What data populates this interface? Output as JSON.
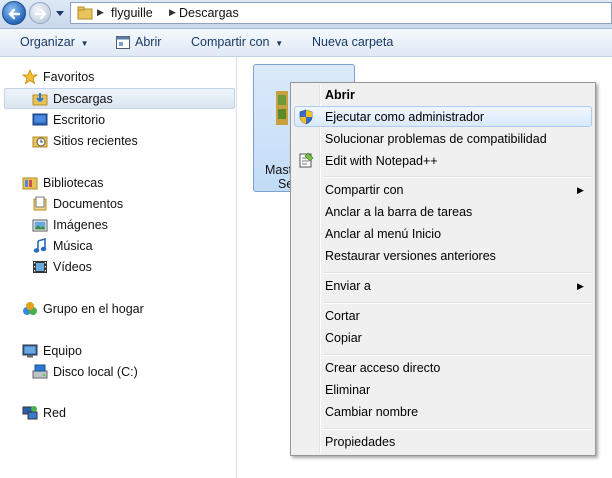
{
  "address_bar": {
    "breadcrumbs": [
      "flyguille",
      "Descargas"
    ]
  },
  "toolbar": {
    "organize_label": "Organizar",
    "open_label": "Abrir",
    "share_label": "Compartir con",
    "new_folder_label": "Nueva carpeta"
  },
  "navigation": {
    "favorites": {
      "label": "Favoritos",
      "items": [
        "Descargas",
        "Escritorio",
        "Sitios recientes"
      ]
    },
    "libraries": {
      "label": "Bibliotecas",
      "items": [
        "Documentos",
        "Imágenes",
        "Música",
        "Vídeos"
      ]
    },
    "homegroup": "Grupo en el hogar",
    "computer": {
      "label": "Equipo",
      "items": [
        "Disco local (C:)"
      ]
    },
    "network": "Red"
  },
  "file": {
    "name_line1": "Mast",
    "name_line2": "Se"
  },
  "context_menu": {
    "items": [
      "Abrir",
      "Ejecutar como administrador",
      "Solucionar problemas de compatibilidad",
      "Edit with Notepad++",
      "Compartir con",
      "Anclar a la barra de tareas",
      "Anclar al menú Inicio",
      "Restaurar versiones anteriores",
      "Enviar a",
      "Cortar",
      "Copiar",
      "Crear acceso directo",
      "Eliminar",
      "Cambiar nombre",
      "Propiedades"
    ],
    "highlighted": "Ejecutar como administrador"
  }
}
